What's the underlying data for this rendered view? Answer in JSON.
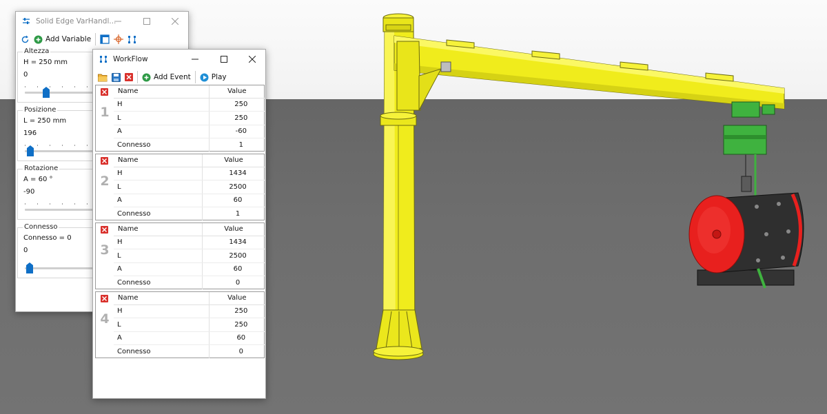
{
  "var_window": {
    "title": "Solid Edge VarHandl...",
    "toolbar": {
      "add_variable_label": "Add Variable"
    },
    "variables": [
      {
        "name": "Altezza",
        "expression": "H = 250 mm",
        "value": "0"
      },
      {
        "name": "Posizione",
        "expression": "L = 250 mm",
        "value": "196"
      },
      {
        "name": "Rotazione",
        "expression": "A = 60 °",
        "value": "-90"
      },
      {
        "name": "Connesso",
        "expression": "Connesso = 0",
        "value": "0"
      }
    ]
  },
  "workflow_window": {
    "title": "WorkFlow",
    "toolbar": {
      "add_event_label": "Add Event",
      "play_label": "Play"
    },
    "columns": {
      "name": "Name",
      "value": "Value"
    },
    "events": [
      {
        "number": "1",
        "rows": [
          {
            "name": "H",
            "value": "250"
          },
          {
            "name": "L",
            "value": "250"
          },
          {
            "name": "A",
            "value": "-60"
          },
          {
            "name": "Connesso",
            "value": "1"
          }
        ]
      },
      {
        "number": "2",
        "rows": [
          {
            "name": "H",
            "value": "1434"
          },
          {
            "name": "L",
            "value": "2500"
          },
          {
            "name": "A",
            "value": "60"
          },
          {
            "name": "Connesso",
            "value": "1"
          }
        ]
      },
      {
        "number": "3",
        "rows": [
          {
            "name": "H",
            "value": "1434"
          },
          {
            "name": "L",
            "value": "2500"
          },
          {
            "name": "A",
            "value": "60"
          },
          {
            "name": "Connesso",
            "value": "0"
          }
        ]
      },
      {
        "number": "4",
        "rows": [
          {
            "name": "H",
            "value": "250"
          },
          {
            "name": "L",
            "value": "250"
          },
          {
            "name": "A",
            "value": "60"
          },
          {
            "name": "Connesso",
            "value": "0"
          }
        ]
      }
    ]
  },
  "colors": {
    "crane_yellow": "#f0ec1c",
    "hoist_green": "#3fb23f",
    "tank_red": "#e8201e",
    "delete_red": "#d9302b",
    "accent_blue": "#0f6fc6"
  }
}
